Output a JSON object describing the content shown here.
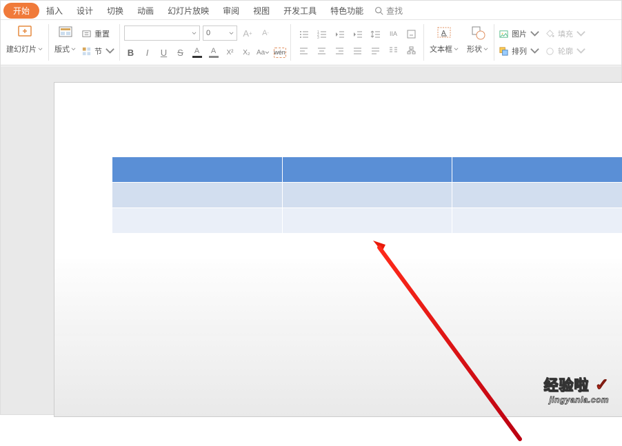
{
  "tabs": {
    "active": "开始",
    "items": [
      "开始",
      "插入",
      "设计",
      "切换",
      "动画",
      "幻灯片放映",
      "审阅",
      "视图",
      "开发工具",
      "特色功能"
    ],
    "search": "查找"
  },
  "ribbon": {
    "newSlide": "建幻灯片",
    "format": "版式",
    "reset": "重置",
    "section": "节",
    "fontSize": "0",
    "textbox": "文本框",
    "shape": "形状",
    "picture": "图片",
    "arrange": "排列",
    "fill": "填充",
    "effects": "轮廓"
  },
  "watermark": {
    "line1": "经验啦",
    "line2": "jingyanla.com"
  }
}
